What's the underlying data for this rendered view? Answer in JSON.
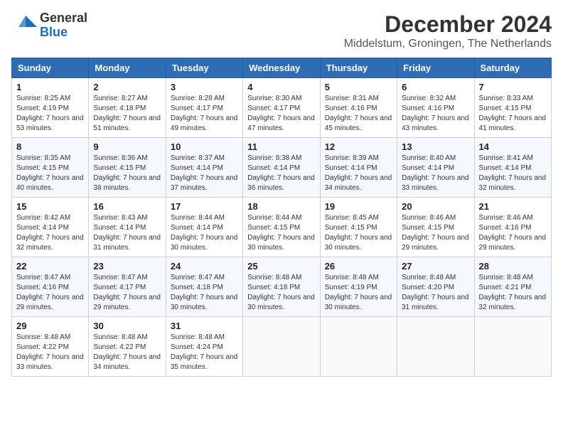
{
  "header": {
    "logo_general": "General",
    "logo_blue": "Blue",
    "month_title": "December 2024",
    "subtitle": "Middelstum, Groningen, The Netherlands"
  },
  "weekdays": [
    "Sunday",
    "Monday",
    "Tuesday",
    "Wednesday",
    "Thursday",
    "Friday",
    "Saturday"
  ],
  "weeks": [
    [
      {
        "day": "1",
        "sunrise": "8:25 AM",
        "sunset": "4:19 PM",
        "daylight": "7 hours and 53 minutes."
      },
      {
        "day": "2",
        "sunrise": "8:27 AM",
        "sunset": "4:18 PM",
        "daylight": "7 hours and 51 minutes."
      },
      {
        "day": "3",
        "sunrise": "8:28 AM",
        "sunset": "4:17 PM",
        "daylight": "7 hours and 49 minutes."
      },
      {
        "day": "4",
        "sunrise": "8:30 AM",
        "sunset": "4:17 PM",
        "daylight": "7 hours and 47 minutes."
      },
      {
        "day": "5",
        "sunrise": "8:31 AM",
        "sunset": "4:16 PM",
        "daylight": "7 hours and 45 minutes."
      },
      {
        "day": "6",
        "sunrise": "8:32 AM",
        "sunset": "4:16 PM",
        "daylight": "7 hours and 43 minutes."
      },
      {
        "day": "7",
        "sunrise": "8:33 AM",
        "sunset": "4:15 PM",
        "daylight": "7 hours and 41 minutes."
      }
    ],
    [
      {
        "day": "8",
        "sunrise": "8:35 AM",
        "sunset": "4:15 PM",
        "daylight": "7 hours and 40 minutes."
      },
      {
        "day": "9",
        "sunrise": "8:36 AM",
        "sunset": "4:15 PM",
        "daylight": "7 hours and 38 minutes."
      },
      {
        "day": "10",
        "sunrise": "8:37 AM",
        "sunset": "4:14 PM",
        "daylight": "7 hours and 37 minutes."
      },
      {
        "day": "11",
        "sunrise": "8:38 AM",
        "sunset": "4:14 PM",
        "daylight": "7 hours and 36 minutes."
      },
      {
        "day": "12",
        "sunrise": "8:39 AM",
        "sunset": "4:14 PM",
        "daylight": "7 hours and 34 minutes."
      },
      {
        "day": "13",
        "sunrise": "8:40 AM",
        "sunset": "4:14 PM",
        "daylight": "7 hours and 33 minutes."
      },
      {
        "day": "14",
        "sunrise": "8:41 AM",
        "sunset": "4:14 PM",
        "daylight": "7 hours and 32 minutes."
      }
    ],
    [
      {
        "day": "15",
        "sunrise": "8:42 AM",
        "sunset": "4:14 PM",
        "daylight": "7 hours and 32 minutes."
      },
      {
        "day": "16",
        "sunrise": "8:43 AM",
        "sunset": "4:14 PM",
        "daylight": "7 hours and 31 minutes."
      },
      {
        "day": "17",
        "sunrise": "8:44 AM",
        "sunset": "4:14 PM",
        "daylight": "7 hours and 30 minutes."
      },
      {
        "day": "18",
        "sunrise": "8:44 AM",
        "sunset": "4:15 PM",
        "daylight": "7 hours and 30 minutes."
      },
      {
        "day": "19",
        "sunrise": "8:45 AM",
        "sunset": "4:15 PM",
        "daylight": "7 hours and 30 minutes."
      },
      {
        "day": "20",
        "sunrise": "8:46 AM",
        "sunset": "4:15 PM",
        "daylight": "7 hours and 29 minutes."
      },
      {
        "day": "21",
        "sunrise": "8:46 AM",
        "sunset": "4:16 PM",
        "daylight": "7 hours and 29 minutes."
      }
    ],
    [
      {
        "day": "22",
        "sunrise": "8:47 AM",
        "sunset": "4:16 PM",
        "daylight": "7 hours and 29 minutes."
      },
      {
        "day": "23",
        "sunrise": "8:47 AM",
        "sunset": "4:17 PM",
        "daylight": "7 hours and 29 minutes."
      },
      {
        "day": "24",
        "sunrise": "8:47 AM",
        "sunset": "4:18 PM",
        "daylight": "7 hours and 30 minutes."
      },
      {
        "day": "25",
        "sunrise": "8:48 AM",
        "sunset": "4:18 PM",
        "daylight": "7 hours and 30 minutes."
      },
      {
        "day": "26",
        "sunrise": "8:48 AM",
        "sunset": "4:19 PM",
        "daylight": "7 hours and 30 minutes."
      },
      {
        "day": "27",
        "sunrise": "8:48 AM",
        "sunset": "4:20 PM",
        "daylight": "7 hours and 31 minutes."
      },
      {
        "day": "28",
        "sunrise": "8:48 AM",
        "sunset": "4:21 PM",
        "daylight": "7 hours and 32 minutes."
      }
    ],
    [
      {
        "day": "29",
        "sunrise": "8:48 AM",
        "sunset": "4:22 PM",
        "daylight": "7 hours and 33 minutes."
      },
      {
        "day": "30",
        "sunrise": "8:48 AM",
        "sunset": "4:22 PM",
        "daylight": "7 hours and 34 minutes."
      },
      {
        "day": "31",
        "sunrise": "8:48 AM",
        "sunset": "4:24 PM",
        "daylight": "7 hours and 35 minutes."
      },
      null,
      null,
      null,
      null
    ]
  ],
  "labels": {
    "sunrise": "Sunrise:",
    "sunset": "Sunset:",
    "daylight": "Daylight:"
  }
}
